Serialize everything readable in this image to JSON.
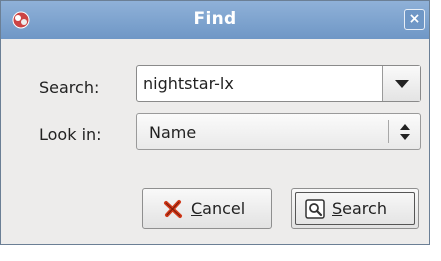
{
  "window": {
    "title": "Find",
    "app_icon": "find-app-icon",
    "close_icon": "close-icon",
    "close_glyph": "×"
  },
  "form": {
    "search_label": "Search:",
    "search_value": "nightstar-lx",
    "search_dropdown_icon": "chevron-down-icon",
    "lookin_label": "Look in:",
    "lookin_value": "Name",
    "lookin_arrows_icon": "up-down-arrows-icon"
  },
  "buttons": {
    "cancel": {
      "mnemonic": "C",
      "rest": "ancel",
      "icon": "cancel-x-icon"
    },
    "search": {
      "mnemonic": "S",
      "rest": "earch",
      "icon": "search-magnifier-icon"
    }
  },
  "colors": {
    "titlebar": "#7ea4cf",
    "dialog_bg": "#edeceb",
    "cancel_icon": "#d23a1a"
  }
}
